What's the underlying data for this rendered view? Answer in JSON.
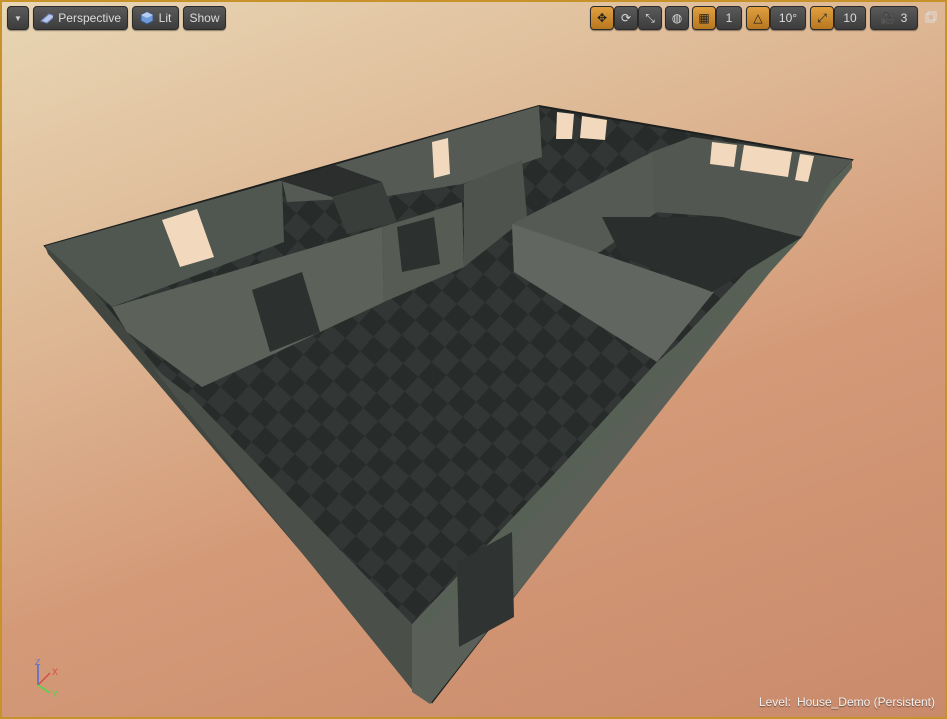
{
  "toolbar": {
    "view_mode": "Perspective",
    "lighting": "Lit",
    "show": "Show",
    "grid_snap_value": "1",
    "rotation_snap_value": "10°",
    "scale_snap_value": "10",
    "camera_speed_value": "3"
  },
  "status": {
    "level_label": "Level:",
    "level_name": "House_Demo (Persistent)"
  },
  "axis": {
    "z": "Z",
    "x": "X",
    "y": "Y"
  },
  "colors": {
    "accent": "#c8922a",
    "active_button": "#d08a2a",
    "wall": "#4b5148",
    "floor_dark": "#262a29",
    "floor_light": "#313635"
  }
}
